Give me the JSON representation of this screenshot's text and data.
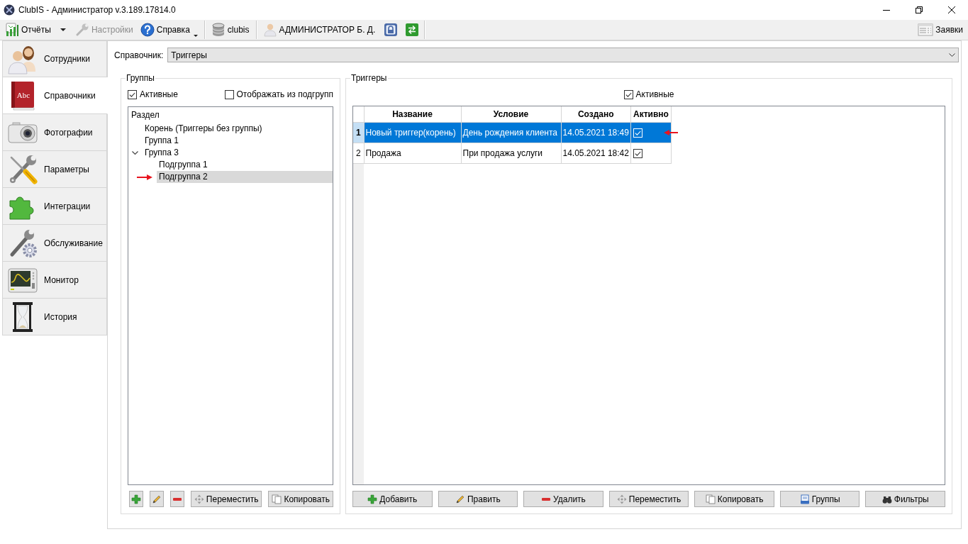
{
  "window": {
    "title": "ClubIS - Администратор v.3.189.17814.0"
  },
  "toolbar": {
    "groups": [
      [
        {
          "kind": "split",
          "label": "Отчёты",
          "disabled": false
        },
        {
          "kind": "button",
          "label": "Настройки",
          "disabled": true
        },
        {
          "kind": "menu",
          "label": "Справка",
          "disabled": false
        }
      ],
      [
        {
          "kind": "button",
          "label": "clubis",
          "disabled": false
        }
      ],
      [
        {
          "kind": "button",
          "label": "АДМИНИСТРАТОР Б. Д.",
          "disabled": false
        },
        {
          "kind": "icon",
          "disabled": false
        },
        {
          "kind": "icon",
          "disabled": false
        }
      ]
    ],
    "right": [
      {
        "kind": "button",
        "label": "Заявки",
        "disabled": false
      }
    ]
  },
  "sidebar": {
    "items": [
      {
        "label": "Сотрудники",
        "selected": false
      },
      {
        "label": "Справочники",
        "selected": true,
        "icon_text": "Abc"
      },
      {
        "label": "Фотографии",
        "selected": false
      },
      {
        "label": "Параметры",
        "selected": false
      },
      {
        "label": "Интеграции",
        "selected": false
      },
      {
        "label": "Обслуживание",
        "selected": false
      },
      {
        "label": "Монитор",
        "selected": false
      },
      {
        "label": "История",
        "selected": false
      }
    ]
  },
  "directory": {
    "label": "Справочник:",
    "value": "Триггеры"
  },
  "groups": {
    "title": "Группы",
    "checkboxes": [
      {
        "label": "Активные",
        "checked": true
      },
      {
        "label": "Отображать из подгрупп",
        "checked": false
      }
    ],
    "tree": {
      "heading": "Раздел",
      "items": [
        {
          "label": "Корень (Триггеры без группы)",
          "selected": false,
          "marked": false
        },
        {
          "label": "Группа 1",
          "selected": false,
          "marked": false
        },
        {
          "label": "Группа 3",
          "selected": false,
          "marked": false,
          "expanded": true,
          "children": [
            {
              "label": "Подгруппа 1",
              "selected": false,
              "marked": false
            },
            {
              "label": "Подгруппа 2",
              "selected": true,
              "marked": true
            }
          ]
        }
      ]
    },
    "buttons": [
      {
        "kind": "add"
      },
      {
        "kind": "edit"
      },
      {
        "kind": "delete"
      },
      {
        "kind": "move",
        "label": "Переместить"
      },
      {
        "kind": "copy",
        "label": "Копировать"
      }
    ]
  },
  "triggers": {
    "title": "Триггеры",
    "checkbox": {
      "label": "Активные",
      "checked": true
    },
    "table": {
      "columns": [
        "Название",
        "Условие",
        "Создано",
        "Активно"
      ],
      "rows": [
        {
          "number": "1",
          "cells": [
            "Новый триггер(корень)",
            "День рождения клиента",
            "14.05.2021 18:49"
          ],
          "active": true,
          "selected": true,
          "marked": true
        },
        {
          "number": "2",
          "cells": [
            "Продажа",
            "При продажа услуги",
            "14.05.2021 18:42"
          ],
          "active": true,
          "selected": false,
          "marked": false
        }
      ]
    },
    "buttons": [
      {
        "kind": "add",
        "label": "Добавить"
      },
      {
        "kind": "edit",
        "label": "Править"
      },
      {
        "kind": "delete",
        "label": "Удалить"
      },
      {
        "kind": "move",
        "label": "Переместить"
      },
      {
        "kind": "copy",
        "label": "Копировать"
      },
      {
        "kind": "groups",
        "label": "Группы"
      },
      {
        "kind": "filter",
        "label": "Фильтры"
      }
    ]
  }
}
